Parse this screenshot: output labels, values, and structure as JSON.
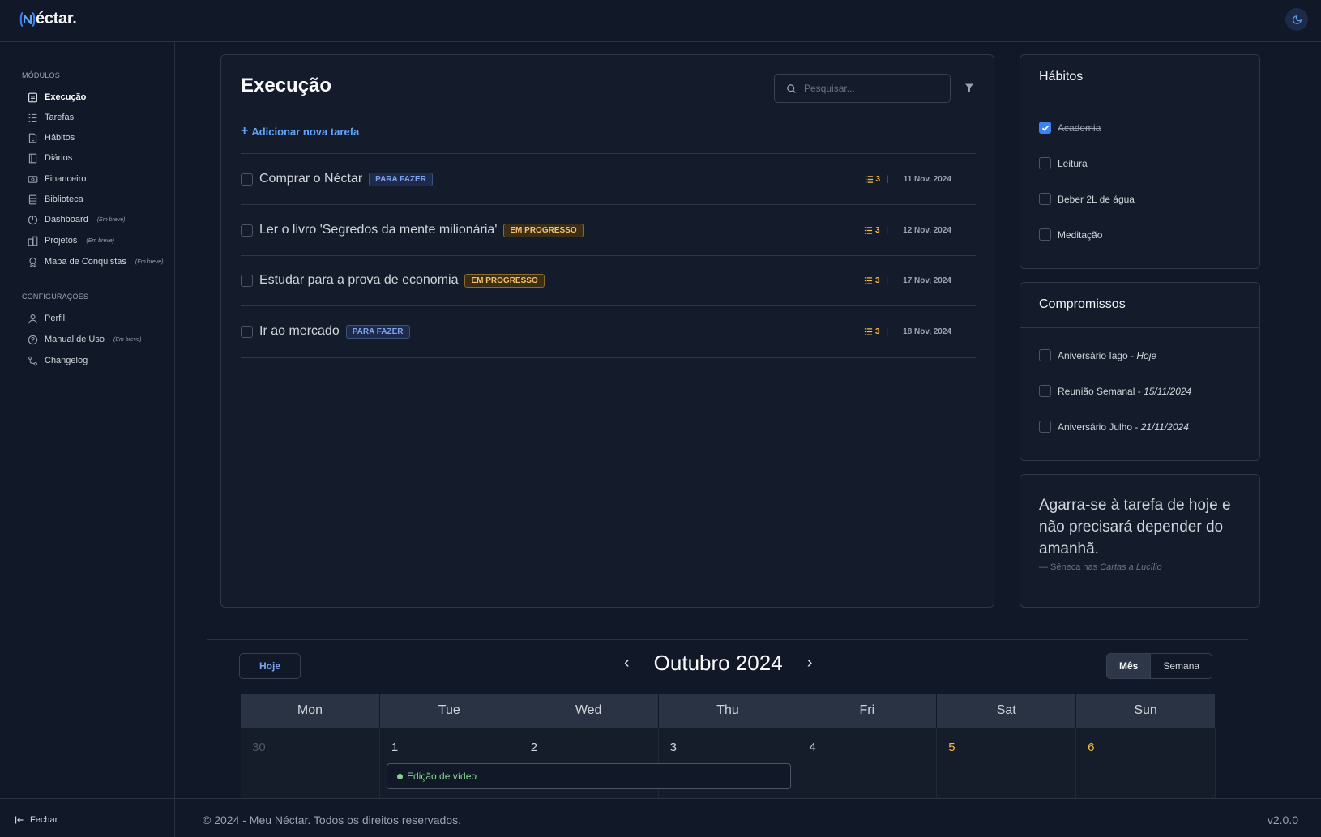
{
  "app": {
    "logo_text": "éctar."
  },
  "sidebar": {
    "sections": [
      {
        "label": "Módulos"
      },
      {
        "label": "Configurações"
      }
    ],
    "modules": [
      {
        "label": "Execução",
        "icon": "checklist-icon",
        "soon": ""
      },
      {
        "label": "Tarefas",
        "icon": "list-icon",
        "soon": ""
      },
      {
        "label": "Hábitos",
        "icon": "document-icon",
        "soon": ""
      },
      {
        "label": "Diários",
        "icon": "book-icon",
        "soon": ""
      },
      {
        "label": "Financeiro",
        "icon": "money-icon",
        "soon": ""
      },
      {
        "label": "Biblioteca",
        "icon": "library-icon",
        "soon": ""
      },
      {
        "label": "Dashboard",
        "icon": "chart-icon",
        "soon": "(Em breve)"
      },
      {
        "label": "Projetos",
        "icon": "projects-icon",
        "soon": "(Em breve)"
      },
      {
        "label": "Mapa de Conquistas",
        "icon": "award-icon",
        "soon": "(Em breve)"
      }
    ],
    "settings": [
      {
        "label": "Perfil",
        "icon": "user-icon",
        "soon": ""
      },
      {
        "label": "Manual de Uso",
        "icon": "help-icon",
        "soon": "(Em breve)"
      },
      {
        "label": "Changelog",
        "icon": "route-icon",
        "soon": ""
      }
    ],
    "close_label": "Fechar"
  },
  "execution": {
    "title": "Execução",
    "search_placeholder": "Pesquisar...",
    "add_task_label": "Adicionar nova tarefa",
    "tasks": [
      {
        "title": "Comprar o Néctar",
        "status": "Para fazer",
        "subtasks": "3",
        "date": "11 Nov, 2024"
      },
      {
        "title": "Ler o livro 'Segredos da mente milionária'",
        "status": "Em progresso",
        "subtasks": "3",
        "date": "12 Nov, 2024"
      },
      {
        "title": "Estudar para a prova de economia",
        "status": "Em progresso",
        "subtasks": "3",
        "date": "17 Nov, 2024"
      },
      {
        "title": "Ir ao mercado",
        "status": "Para fazer",
        "subtasks": "3",
        "date": "18 Nov, 2024"
      }
    ]
  },
  "habits": {
    "title": "Hábitos",
    "items": [
      {
        "label": "Academia",
        "checked": true
      },
      {
        "label": "Leitura",
        "checked": false
      },
      {
        "label": "Beber 2L de água",
        "checked": false
      },
      {
        "label": "Meditação",
        "checked": false
      }
    ]
  },
  "appointments": {
    "title": "Compromissos",
    "items": [
      {
        "label": "Aniversário Iago - ",
        "date": "Hoje"
      },
      {
        "label": "Reunião Semanal - ",
        "date": "15/11/2024"
      },
      {
        "label": "Aniversário Julho - ",
        "date": "21/11/2024"
      }
    ]
  },
  "quote": {
    "text": "Agarra-se à tarefa de hoje e não precisará depender do amanhã.",
    "author_prefix": "— Sêneca nas ",
    "source": "Cartas a Lucílio"
  },
  "calendar": {
    "today_label": "Hoje",
    "title": "Outubro 2024",
    "prev": "‹",
    "next": "›",
    "views": [
      "Mês",
      "Semana"
    ],
    "active_view": "Mês",
    "weekdays": [
      "Mon",
      "Tue",
      "Wed",
      "Thu",
      "Fri",
      "Sat",
      "Sun"
    ],
    "days": [
      "30",
      "1",
      "2",
      "3",
      "4",
      "5",
      "6"
    ],
    "event": "Edição de vídeo"
  },
  "footer": {
    "copyright": "© 2024 - Meu Néctar. Todos os direitos reservados.",
    "version": "v2.0.0"
  },
  "colors": {
    "accent": "#3b82f6",
    "todo_badge": "#7fa2f0",
    "progress_badge": "#f5c16b",
    "weekend": "#f5b94a",
    "event": "#86d48b"
  }
}
